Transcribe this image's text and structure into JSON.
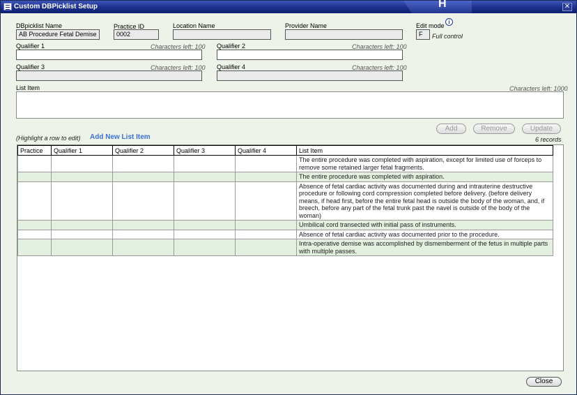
{
  "window": {
    "title": "Custom DBPicklist Setup",
    "title_glyph": "H"
  },
  "fields": {
    "dbpicklist_name": {
      "label": "DBpicklist Name",
      "value": "AB Procedure Fetal Demise"
    },
    "practice_id": {
      "label": "Practice ID",
      "value": "0002"
    },
    "location_name": {
      "label": "Location Name",
      "value": ""
    },
    "provider_name": {
      "label": "Provider Name",
      "value": ""
    },
    "edit_mode": {
      "label": "Edit mode",
      "value": "F",
      "description": "Full control"
    },
    "qualifier1": {
      "label": "Qualifier 1",
      "chars_left": "Characters left: 100",
      "value": ""
    },
    "qualifier2": {
      "label": "Qualifier 2",
      "chars_left": "Characters left: 100",
      "value": ""
    },
    "qualifier3": {
      "label": "Qualifier 3",
      "chars_left": "Characters left: 100",
      "value": ""
    },
    "qualifier4": {
      "label": "Qualifier 4",
      "chars_left": "Characters left: 100",
      "value": ""
    },
    "list_item": {
      "label": "List Item",
      "chars_left": "Characters left: 1000",
      "value": ""
    }
  },
  "buttons": {
    "add": "Add",
    "remove": "Remove",
    "update": "Update",
    "close": "Close"
  },
  "hint": "(Highlight a row to edit)",
  "add_new_link": "Add New List Item",
  "record_count": "6 records",
  "table": {
    "columns": [
      "Practice",
      "Qualifier 1",
      "Qualifier 2",
      "Qualifier 3",
      "Qualifier 4",
      "List Item"
    ],
    "rows": [
      [
        "",
        "",
        "",
        "",
        "",
        "The entire procedure was completed with aspiration, except for limited use of forceps to remove some retained larger fetal fragments."
      ],
      [
        "",
        "",
        "",
        "",
        "",
        "The entire procedure was completed with aspiration."
      ],
      [
        "",
        "",
        "",
        "",
        "",
        "Absence of fetal cardiac activity was documented during and intrauterine destructive procedure or following cord compression completed before delivery. (before delivery means, if head first, before the entire fetal head is outside the body of the woman, and, if breech, before any part of the fetal trunk past the navel is outside of the body of the woman)"
      ],
      [
        "",
        "",
        "",
        "",
        "",
        "Umbilical cord transected with initial pass of instruments."
      ],
      [
        "",
        "",
        "",
        "",
        "",
        "Absence of fetal cardiac activity was documented prior to the procedure."
      ],
      [
        "",
        "",
        "",
        "",
        "",
        "Intra-operative demise was accomplished by dismemberment of the fetus in multiple parts with multiple passes."
      ]
    ]
  }
}
